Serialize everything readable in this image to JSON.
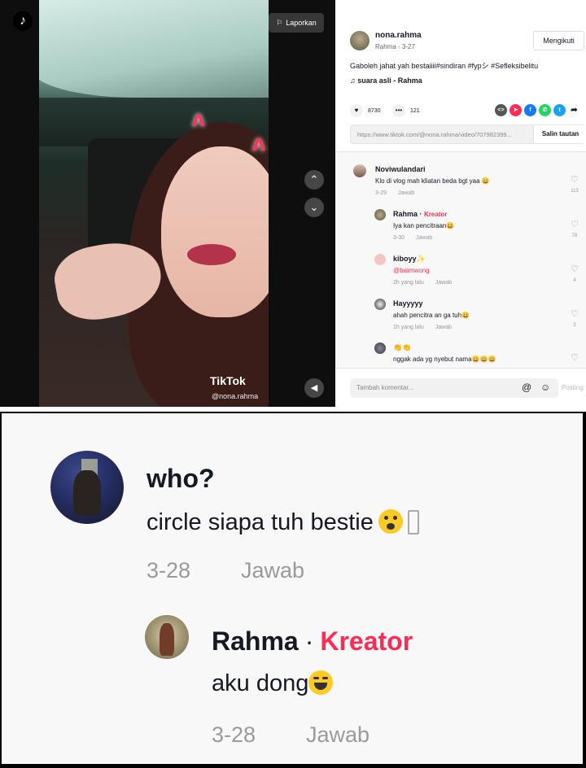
{
  "player": {
    "report_label": "Laporkan",
    "watermark_brand": "TikTok",
    "watermark_handle": "@nona.rahma",
    "logo_icon": "tiktok-logo",
    "up_icon": "chevron-up",
    "down_icon": "chevron-down",
    "sound_icon": "volume"
  },
  "post": {
    "username": "nona.rahma",
    "subline": "Rahma · 3-27",
    "follow_label": "Mengikuti",
    "caption": "Gaboleh jahat yah bestaiiii#sindiran #fypシ #Sefleksibelitu",
    "sound": "suara asli - Rahma",
    "likes": "8730",
    "comments_count": "121",
    "link": "https://www.tiktok.com/@nona.rahma/video/707982399...",
    "copy_label": "Salin tautan"
  },
  "comments": [
    {
      "name": "Noviwulandari",
      "text": "Klo di vlog mah kliatan beda bgt yaa 😀",
      "date": "3-29",
      "reply": "Jawab",
      "likes": "113"
    },
    {
      "name": "Rahma",
      "badge": "Kreator",
      "text": "Iya kan pencitraan😀",
      "date": "3-30",
      "reply": "Jawab",
      "likes": "78"
    },
    {
      "name": "kiboyy✨",
      "text": "@baimwong",
      "date": "2h yang lalu",
      "reply": "Jawab",
      "likes": "4"
    },
    {
      "name": "Hayyyyy",
      "text": "ahah pencitra an ga tuh😀",
      "date": "1h yang lalu",
      "reply": "Jawab",
      "likes": "3"
    },
    {
      "name": "👏👏",
      "text": "nggak ada yg nyebut nama😀😀😀",
      "date": "",
      "reply": "",
      "likes": ""
    }
  ],
  "composer": {
    "placeholder": "Tambah komentar...",
    "at_icon": "@",
    "post_label": "Posting"
  },
  "zoom": {
    "comment": {
      "name": "who?",
      "text": "circle siapa tuh bestie",
      "date": "3-28",
      "reply": "Jawab"
    },
    "reply": {
      "name": "Rahma",
      "separator": "·",
      "badge": "Kreator",
      "text": "aku dong",
      "date": "3-28",
      "reply": "Jawab"
    }
  }
}
